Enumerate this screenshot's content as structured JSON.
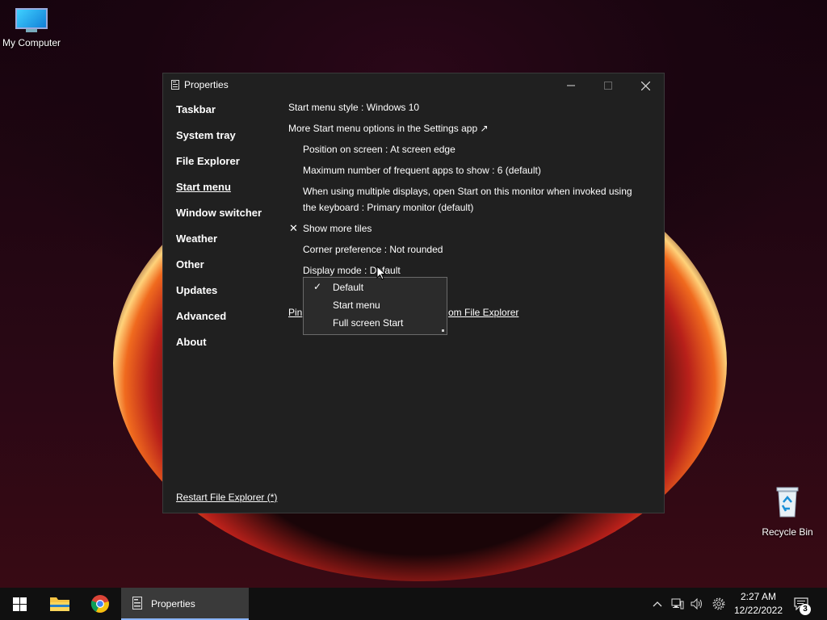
{
  "desktop": {
    "icons": [
      {
        "label": "My Computer"
      },
      {
        "label": "Recycle Bin"
      }
    ]
  },
  "window": {
    "title": "Properties",
    "nav": [
      {
        "label": "Taskbar",
        "active": false
      },
      {
        "label": "System tray",
        "active": false
      },
      {
        "label": "File Explorer",
        "active": false
      },
      {
        "label": "Start menu",
        "active": true
      },
      {
        "label": "Window switcher",
        "active": false
      },
      {
        "label": "Weather",
        "active": false
      },
      {
        "label": "Other",
        "active": false
      },
      {
        "label": "Updates",
        "active": false
      },
      {
        "label": "Advanced",
        "active": false
      },
      {
        "label": "About",
        "active": false
      }
    ],
    "settings": {
      "start_menu_style": "Start menu style : Windows 10",
      "more_options_link": "More Start menu options in the Settings app ↗",
      "position": "Position on screen : At screen edge",
      "max_frequent": "Maximum number of frequent apps to show : 6 (default)",
      "multi_display_line1": "When using multiple displays, open Start on this monitor when invoked using",
      "multi_display_line2": "the keyboard : Primary monitor (default)",
      "show_more_tiles": "Show more tiles",
      "show_more_tiles_mark": "✕",
      "corner_pref": "Corner preference : Not rounded",
      "display_mode": "Display mode : Default",
      "pin_link_left": "Pin",
      "pin_link_right": "om File Explorer"
    },
    "dropdown": {
      "options": [
        {
          "label": "Default",
          "checked": true
        },
        {
          "label": "Start menu",
          "checked": false
        },
        {
          "label": "Full screen Start",
          "checked": false
        }
      ],
      "check_glyph": "✓"
    },
    "restart_link": "Restart File Explorer (*)"
  },
  "taskbar": {
    "task_label": "Properties",
    "clock_time": "2:27 AM",
    "clock_date": "12/22/2022",
    "notification_count": "3",
    "accent": "#8ab4f8"
  }
}
